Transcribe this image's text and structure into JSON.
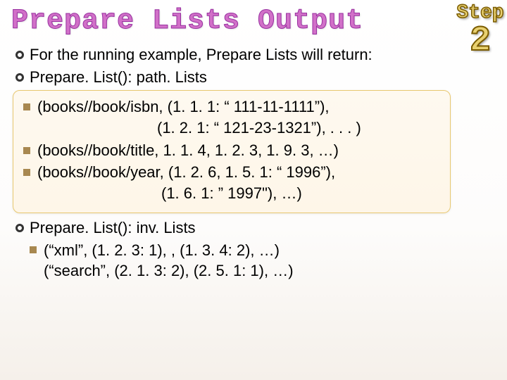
{
  "title": "Prepare Lists Output",
  "badge": {
    "word": "Step",
    "num": "2"
  },
  "intro": "For the running example, Prepare Lists will return:",
  "path": {
    "heading": "Prepare. List(): path. Lists",
    "items": [
      {
        "l1": "(books//book/isbn, (1. 1. 1: “ 111-11-1111”),",
        "l2": "(1. 2. 1: “ 121-23-1321”), . . . )"
      },
      {
        "l1": "(books//book/title, 1. 1. 4, 1. 2. 3, 1. 9. 3, …)"
      },
      {
        "l1": "(books//book/year, (1. 2. 6, 1. 5. 1: “ 1996”),",
        "l2": "(1. 6. 1: ” 1997\"), …)"
      }
    ]
  },
  "inv": {
    "heading": "Prepare. List(): inv. Lists",
    "items": [
      {
        "l1": "(“xml”, (1. 2. 3: 1), , (1. 3. 4: 2), …)",
        "l2": "(“search”, (2. 1. 3: 2), (2. 5. 1: 1), …)"
      }
    ]
  }
}
